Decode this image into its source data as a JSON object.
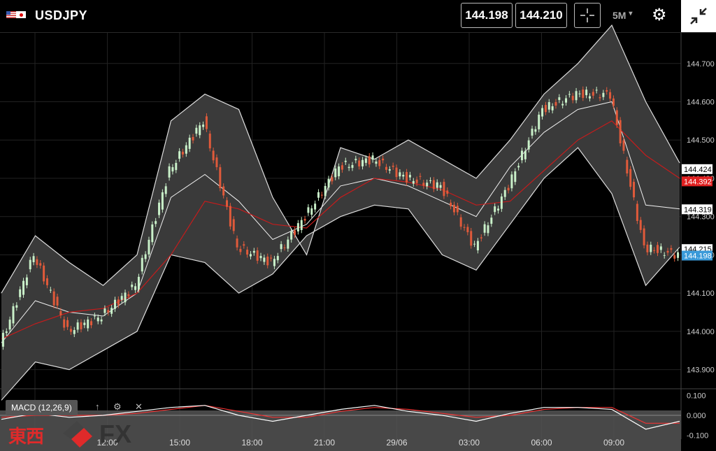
{
  "header": {
    "symbol": "USDJPY",
    "bid": "144.198",
    "ask": "144.210",
    "timeframe": "5M",
    "timeframe_caret": "▾",
    "settings_icon": "gear-icon",
    "crosshair_icon": "crosshair-icon",
    "compress_icon": "compress-icon"
  },
  "indicator": {
    "label": "MACD (12,26,9)",
    "up_icon": "↑",
    "settings_icon": "⚙",
    "close_icon": "✕"
  },
  "logo": {
    "text_jp": "東西",
    "text_fx": "FX"
  },
  "chart_data": {
    "type": "line",
    "x": [
      "",
      "12:00",
      "15:00",
      "18:00",
      "21:00",
      "29/06",
      "03:00",
      "06:00",
      "09:00"
    ],
    "y_axis": {
      "ylim": [
        143.85,
        144.78
      ],
      "ticks": [
        "144.700",
        "144.600",
        "144.500",
        "144.400",
        "144.300",
        "144.200",
        "144.100",
        "144.000",
        "143.900"
      ]
    },
    "price_tags": [
      {
        "value": 144.424,
        "label": "144.424",
        "color": "#ffffff",
        "text": "#000000"
      },
      {
        "value": 144.392,
        "label": "144.392",
        "color": "#e02020",
        "text": "#ffffff"
      },
      {
        "value": 144.319,
        "label": "144.319",
        "color": "#ffffff",
        "text": "#000000"
      },
      {
        "value": 144.215,
        "label": "144.215",
        "color": "#ffffff",
        "text": "#000000"
      },
      {
        "value": 144.198,
        "label": "144.198",
        "color": "#3a9ad9",
        "text": "#ffffff"
      }
    ],
    "bollinger_upper": [
      144.1,
      144.25,
      144.18,
      144.12,
      144.2,
      144.55,
      144.62,
      144.58,
      144.35,
      144.2,
      144.48,
      144.45,
      144.5,
      144.45,
      144.4,
      144.5,
      144.62,
      144.7,
      144.8,
      144.6,
      144.44
    ],
    "bollinger_middle": [
      143.97,
      144.08,
      144.05,
      144.04,
      144.1,
      144.35,
      144.41,
      144.34,
      144.24,
      144.28,
      144.38,
      144.4,
      144.38,
      144.34,
      144.3,
      144.43,
      144.52,
      144.58,
      144.6,
      144.33,
      144.32
    ],
    "bollinger_lower": [
      143.82,
      143.92,
      143.9,
      143.95,
      144.0,
      144.2,
      144.18,
      144.1,
      144.15,
      144.25,
      144.3,
      144.33,
      144.32,
      144.2,
      144.16,
      144.28,
      144.4,
      144.48,
      144.36,
      144.12,
      144.22
    ],
    "moving_average": [
      143.98,
      144.02,
      144.05,
      144.06,
      144.1,
      144.2,
      144.34,
      144.32,
      144.28,
      144.27,
      144.35,
      144.4,
      144.39,
      144.37,
      144.33,
      144.34,
      144.42,
      144.5,
      144.55,
      144.46,
      144.4
    ],
    "price": [
      143.96,
      144.2,
      144.0,
      144.04,
      144.12,
      144.42,
      144.55,
      144.22,
      144.18,
      144.3,
      144.43,
      144.45,
      144.4,
      144.38,
      144.22,
      144.38,
      144.58,
      144.62,
      144.62,
      144.22,
      144.2
    ],
    "macd": {
      "ticks": [
        "0.100",
        "0.000",
        "-0.100"
      ],
      "ylim": [
        -0.12,
        0.12
      ]
    },
    "macd_line": [
      -0.02,
      0.01,
      -0.01,
      0.0,
      0.02,
      0.04,
      0.05,
      0.0,
      -0.03,
      0.0,
      0.03,
      0.05,
      0.02,
      0.0,
      -0.03,
      0.01,
      0.04,
      0.04,
      0.03,
      -0.07,
      -0.03
    ],
    "macd_signal": [
      -0.01,
      0.0,
      0.0,
      0.0,
      0.01,
      0.03,
      0.05,
      0.02,
      -0.01,
      -0.01,
      0.02,
      0.04,
      0.03,
      0.01,
      -0.01,
      0.0,
      0.03,
      0.04,
      0.04,
      -0.04,
      -0.04
    ]
  }
}
